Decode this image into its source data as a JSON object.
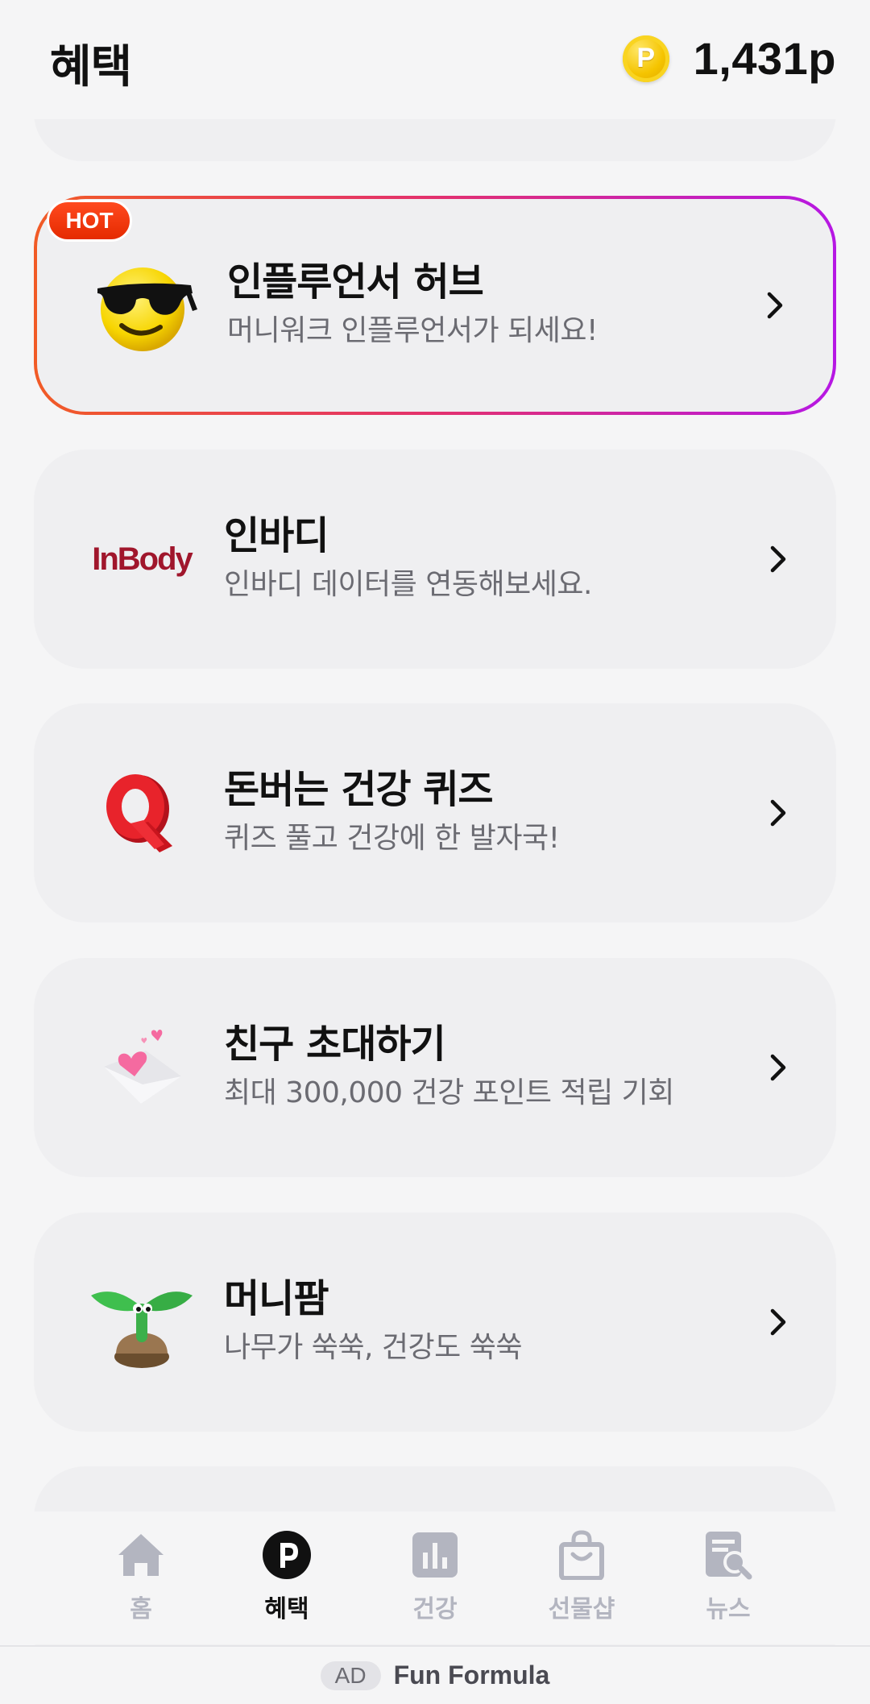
{
  "header": {
    "title": "혜택",
    "points": "1,431p",
    "coin_symbol": "P"
  },
  "hot_badge": "HOT",
  "cards": [
    {
      "title": "인플루언서 허브",
      "subtitle": "머니워크 인플루언서가 되세요!",
      "icon": "sunglasses-emoji-icon"
    },
    {
      "title": "인바디",
      "subtitle": "인바디 데이터를 연동해보세요.",
      "icon": "inbody-logo",
      "logo_text": "InBody"
    },
    {
      "title": "돈버는 건강 퀴즈",
      "subtitle": "퀴즈 풀고 건강에 한 발자국!",
      "icon": "quiz-q-icon"
    },
    {
      "title": "친구 초대하기",
      "subtitle": "최대 300,000 건강 포인트 적립 기회",
      "icon": "heart-envelope-icon"
    },
    {
      "title": "머니팜",
      "subtitle": "나무가 쑥쑥, 건강도 쑥쑥",
      "icon": "sprout-icon"
    }
  ],
  "tabs": [
    {
      "label": "홈",
      "icon": "home-icon",
      "active": false
    },
    {
      "label": "혜택",
      "icon": "points-icon",
      "active": true
    },
    {
      "label": "건강",
      "icon": "chart-icon",
      "active": false
    },
    {
      "label": "선물샵",
      "icon": "shopping-bag-icon",
      "active": false
    },
    {
      "label": "뉴스",
      "icon": "news-search-icon",
      "active": false
    }
  ],
  "ad": {
    "tag": "AD",
    "text": "Fun Formula"
  },
  "colors": {
    "hot_gradient_start": "#f15b26",
    "hot_gradient_end": "#b617e4",
    "tab_inactive": "#b3b5c0",
    "tab_active": "#111111",
    "card_bg": "#efeff1"
  }
}
